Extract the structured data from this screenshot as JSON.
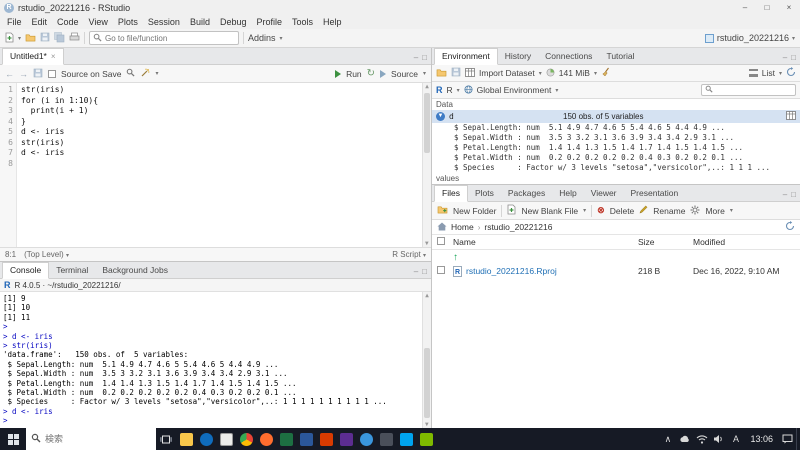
{
  "titlebar": {
    "title": "rstudio_20221216 - RStudio"
  },
  "menubar": [
    "File",
    "Edit",
    "Code",
    "View",
    "Plots",
    "Session",
    "Build",
    "Debug",
    "Profile",
    "Tools",
    "Help"
  ],
  "toolbar": {
    "goto_placeholder": "Go to file/function",
    "addins": "Addins",
    "project": "rstudio_20221216"
  },
  "source": {
    "tab": "Untitled1*",
    "source_on_save": "Source on Save",
    "run": "Run",
    "source_btn": "Source",
    "line_numbers": [
      "1",
      "2",
      "3",
      "4",
      "5",
      "6",
      "7",
      "8"
    ],
    "code": [
      "str(iris)",
      "for (i in 1:10){",
      "  print(i + 1)",
      "}",
      "d <- iris",
      "str(iris)",
      "d <- iris",
      ""
    ],
    "status": {
      "position": "8:1",
      "scope": "(Top Level)",
      "type": "R Script"
    }
  },
  "console": {
    "tabs": [
      "Console",
      "Terminal",
      "Background Jobs"
    ],
    "header": "R 4.0.5 · ~/rstudio_20221216/",
    "lines": [
      {
        "kind": "out",
        "text": "[1] 9"
      },
      {
        "kind": "out",
        "text": "[1] 10"
      },
      {
        "kind": "out",
        "text": "[1] 11"
      },
      {
        "kind": "in",
        "text": ">"
      },
      {
        "kind": "in",
        "text": "> d <- iris"
      },
      {
        "kind": "in",
        "text": "> str(iris)"
      },
      {
        "kind": "out",
        "text": "'data.frame':   150 obs. of  5 variables:"
      },
      {
        "kind": "out",
        "text": " $ Sepal.Length: num  5.1 4.9 4.7 4.6 5 5.4 4.6 5 4.4 4.9 ..."
      },
      {
        "kind": "out",
        "text": " $ Sepal.Width : num  3.5 3 3.2 3.1 3.6 3.9 3.4 3.4 2.9 3.1 ..."
      },
      {
        "kind": "out",
        "text": " $ Petal.Length: num  1.4 1.4 1.3 1.5 1.4 1.7 1.4 1.5 1.4 1.5 ..."
      },
      {
        "kind": "out",
        "text": " $ Petal.Width : num  0.2 0.2 0.2 0.2 0.2 0.4 0.3 0.2 0.2 0.1 ..."
      },
      {
        "kind": "out",
        "text": " $ Species     : Factor w/ 3 levels \"setosa\",\"versicolor\",..: 1 1 1 1 1 1 1 1 1 1 ..."
      },
      {
        "kind": "in",
        "text": "> d <- iris"
      },
      {
        "kind": "in",
        "text": ">"
      }
    ]
  },
  "environment": {
    "tabs": [
      "Environment",
      "History",
      "Connections",
      "Tutorial"
    ],
    "import_dataset": "Import Dataset",
    "memory": "141 MiB",
    "list_label": "List",
    "scope_r": "R",
    "scope_env": "Global Environment",
    "section_data": "Data",
    "object": {
      "name": "d",
      "summary": "150 obs. of 5 variables"
    },
    "details": [
      "$ Sepal.Length: num  5.1 4.9 4.7 4.6 5 5.4 4.6 5 4.4 4.9 ...",
      "$ Sepal.Width : num  3.5 3 3.2 3.1 3.6 3.9 3.4 3.4 2.9 3.1 ...",
      "$ Petal.Length: num  1.4 1.4 1.3 1.5 1.4 1.7 1.4 1.5 1.4 1.5 ...",
      "$ Petal.Width : num  0.2 0.2 0.2 0.2 0.2 0.4 0.3 0.2 0.2 0.1 ...",
      "$ Species     : Factor w/ 3 levels \"setosa\",\"versicolor\",..: 1 1 1 ..."
    ],
    "section_values": "values"
  },
  "files": {
    "tabs": [
      "Files",
      "Plots",
      "Packages",
      "Help",
      "Viewer",
      "Presentation"
    ],
    "toolbar": {
      "new_folder": "New Folder",
      "new_blank_file": "New Blank File",
      "delete": "Delete",
      "rename": "Rename",
      "more": "More"
    },
    "breadcrumb": [
      "Home",
      "rstudio_20221216"
    ],
    "columns": {
      "name": "Name",
      "size": "Size",
      "modified": "Modified"
    },
    "rows": [
      {
        "name": "rstudio_20221216.Rproj",
        "size": "218 B",
        "modified": "Dec 16, 2022, 9:10 AM"
      }
    ]
  },
  "taskbar": {
    "search_placeholder": "検索",
    "ime": "A",
    "time": "13:06"
  }
}
